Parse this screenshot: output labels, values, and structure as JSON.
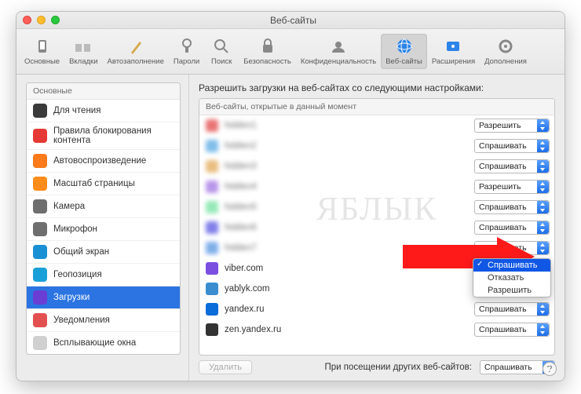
{
  "window": {
    "title": "Веб-сайты"
  },
  "toolbar": {
    "items": [
      {
        "label": "Основные"
      },
      {
        "label": "Вкладки"
      },
      {
        "label": "Автозаполнение"
      },
      {
        "label": "Пароли"
      },
      {
        "label": "Поиск"
      },
      {
        "label": "Безопасность"
      },
      {
        "label": "Конфиденциальность"
      },
      {
        "label": "Веб-сайты"
      },
      {
        "label": "Расширения"
      },
      {
        "label": "Дополнения"
      }
    ]
  },
  "sidebar": {
    "header": "Основные",
    "items": [
      {
        "label": "Для чтения",
        "color": "#3a3a3a"
      },
      {
        "label": "Правила блокирования контента",
        "color": "#e53935"
      },
      {
        "label": "Автовоспроизведение",
        "color": "#ff7a1a"
      },
      {
        "label": "Масштаб страницы",
        "color": "#ff8c1a"
      },
      {
        "label": "Камера",
        "color": "#6e6e6e"
      },
      {
        "label": "Микрофон",
        "color": "#6e6e6e"
      },
      {
        "label": "Общий экран",
        "color": "#1a90d4"
      },
      {
        "label": "Геопозиция",
        "color": "#1aa0d8"
      },
      {
        "label": "Загрузки",
        "color": "#6a3ed4",
        "selected": true
      },
      {
        "label": "Уведомления",
        "color": "#e25050"
      },
      {
        "label": "Всплывающие окна",
        "color": "#d0d0d0"
      }
    ]
  },
  "main": {
    "heading": "Разрешить загрузки на веб-сайтах со следующими настройками:",
    "list_header": "Веб-сайты, открытые в данный момент",
    "sites": [
      {
        "name": "hidden1",
        "fav": "#e03a3a",
        "value": "Разрешить",
        "blurred": true
      },
      {
        "name": "hidden2",
        "fav": "#4aa3e0",
        "value": "Спрашивать",
        "blurred": true
      },
      {
        "name": "hidden3",
        "fav": "#e0a34a",
        "value": "Спрашивать",
        "blurred": true
      },
      {
        "name": "hidden4",
        "fav": "#9a6ae0",
        "value": "Разрешить",
        "blurred": true
      },
      {
        "name": "hidden5",
        "fav": "#6ae09a",
        "value": "Спрашивать",
        "blurred": true
      },
      {
        "name": "hidden6",
        "fav": "#4a4ae0",
        "value": "Спрашивать",
        "blurred": true
      },
      {
        "name": "hidden7",
        "fav": "#4a8ee0",
        "value": "Спрашивать",
        "blurred": true
      },
      {
        "name": "viber.com",
        "fav": "#7b4fe0",
        "value": "",
        "open_menu": true
      },
      {
        "name": "yablyk.com",
        "fav": "#3a8ed0",
        "value": ""
      },
      {
        "name": "yandex.ru",
        "fav": "#0a6cd8",
        "value": "Спрашивать"
      },
      {
        "name": "zen.yandex.ru",
        "fav": "#333333",
        "value": "Спрашивать"
      }
    ],
    "menu": {
      "options": [
        "Спрашивать",
        "Отказать",
        "Разрешить"
      ],
      "selected": "Спрашивать"
    },
    "delete_label": "Удалить",
    "footer_label": "При посещении других веб-сайтов:",
    "footer_value": "Спрашивать"
  },
  "watermark": "ЯБЛЫК"
}
